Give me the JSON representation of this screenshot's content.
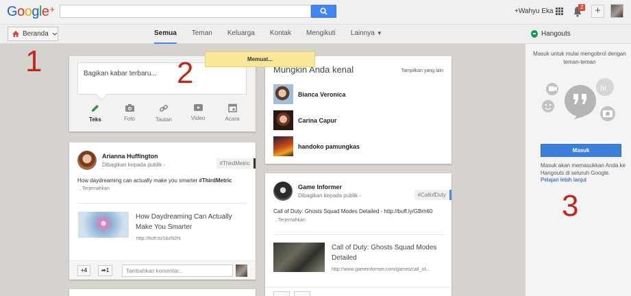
{
  "header": {
    "logo_word": "Google",
    "logo_plus": "+",
    "user_name": "+Wahyu Eka",
    "notification_count": "2"
  },
  "nav": {
    "home_label": "Beranda",
    "tabs": [
      "Semua",
      "Teman",
      "Keluarga",
      "Kontak",
      "Mengikuti",
      "Lainnya"
    ],
    "active_tab": "Semua",
    "hangouts_label": "Hangouts"
  },
  "share": {
    "placeholder": "Bagikan kabar terbaru...",
    "actions": [
      "Teks",
      "Foto",
      "Tautan",
      "Video",
      "Acara"
    ]
  },
  "loading_text": "Memuat...",
  "posts": [
    {
      "author": "Arianna Huffington",
      "visibility": "Dibagikan kepada publik",
      "hashtag": "#ThirdMetric",
      "text": "How daydreaming can actually make you smarter",
      "text_tag": "#ThirdMetric",
      "translate": "Terjemahkan",
      "link_title": "How Daydreaming Can Actually Make You Smarter",
      "link_url": "http://huff.to/1bzN2hl",
      "plus_count": "+4",
      "share_count": "1",
      "comment_placeholder": "Tambahkan komentar..."
    },
    {
      "author": "Game Informer",
      "visibility": "Dibagikan kepada publik",
      "hashtag": "#CallofDuty",
      "text": "Call of Duty: Ghosts Squad Modes Detailed - http://buff.ly/GBrh60",
      "translate": "Terjemahkan",
      "link_title": "Call of Duty: Ghosts Squad Modes Detailed",
      "link_url": "http://www.gameinformer.com/games/call_of..."
    }
  ],
  "suggestions": {
    "title": "Mungkin Anda kenal",
    "show_more": "Tampilkan yang lain",
    "people": [
      "Bianca Veronica",
      "Carina Capur",
      "handoko pamungkas"
    ]
  },
  "sidebar": {
    "message": "Masuk untuk mulai mengobrol dengan teman-teman",
    "button": "Masuk",
    "info": "Masuk akan memasukkan Anda ke Hangouts di seluruh Google.",
    "learn_more": "Pelajari lebih lanjut"
  },
  "annotations": [
    "1",
    "2",
    "3"
  ],
  "colors": {
    "accent_blue": "#4285f4",
    "hangouts_green": "#0f9d58",
    "annotation_red": "#c0281b",
    "loading_yellow": "#f9e79a"
  }
}
